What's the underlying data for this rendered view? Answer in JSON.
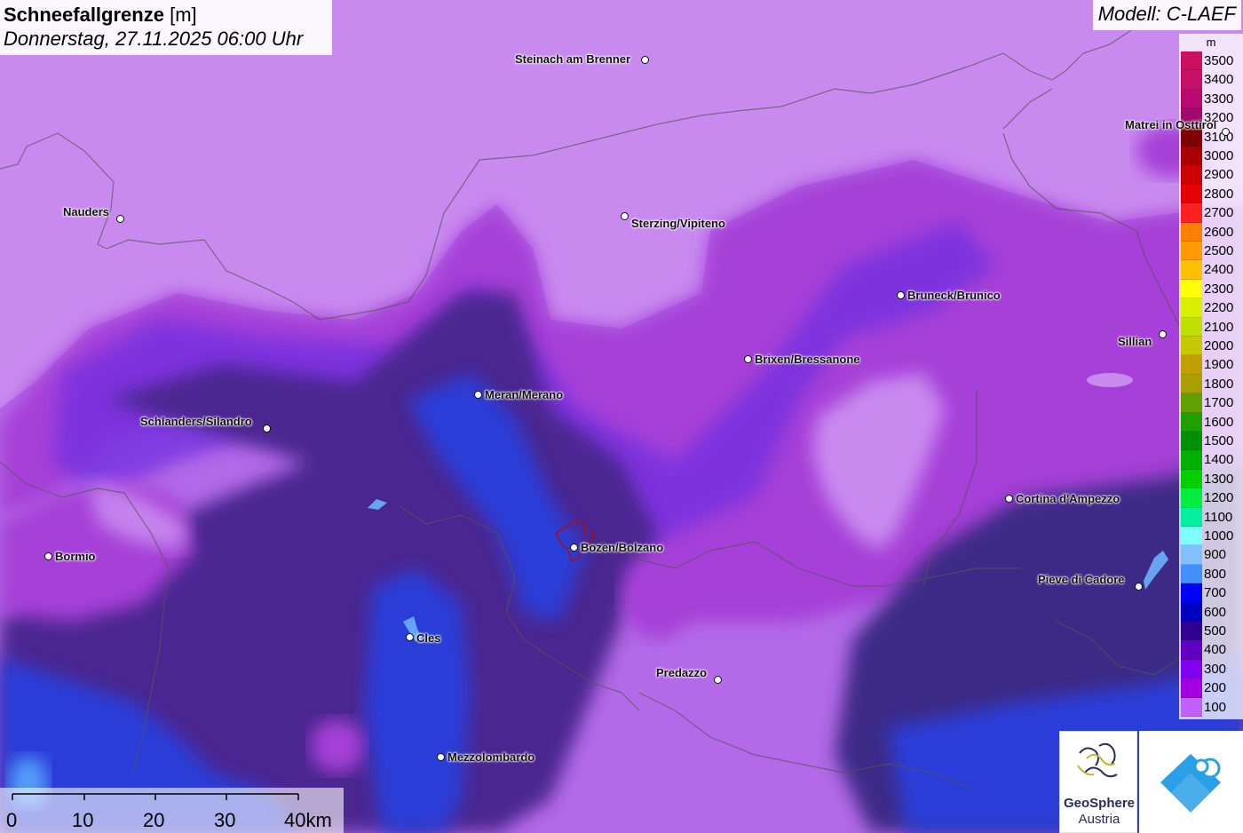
{
  "title": {
    "variable": "Schneefallgrenze",
    "unit": "[m]",
    "datetime": "Donnerstag, 27.11.2025 06:00 Uhr"
  },
  "model": "Modell: C-LAEF",
  "legend": {
    "unit": "m",
    "entries": [
      {
        "label": "3500",
        "color": "#cc1060"
      },
      {
        "label": "3400",
        "color": "#c8106a"
      },
      {
        "label": "3300",
        "color": "#b80a70"
      },
      {
        "label": "3200",
        "color": "#a00a6c"
      },
      {
        "label": "3100",
        "color": "#800000"
      },
      {
        "label": "3000",
        "color": "#a80000"
      },
      {
        "label": "2900",
        "color": "#cc0000"
      },
      {
        "label": "2800",
        "color": "#e80000"
      },
      {
        "label": "2700",
        "color": "#ff2020"
      },
      {
        "label": "2600",
        "color": "#ff7f00"
      },
      {
        "label": "2500",
        "color": "#ff9a00"
      },
      {
        "label": "2400",
        "color": "#ffc000"
      },
      {
        "label": "2300",
        "color": "#ffff00"
      },
      {
        "label": "2200",
        "color": "#d8f000"
      },
      {
        "label": "2100",
        "color": "#c0e000"
      },
      {
        "label": "2000",
        "color": "#c8c800"
      },
      {
        "label": "1900",
        "color": "#c0a000"
      },
      {
        "label": "1800",
        "color": "#a8a000"
      },
      {
        "label": "1700",
        "color": "#60a000"
      },
      {
        "label": "1600",
        "color": "#20a000"
      },
      {
        "label": "1500",
        "color": "#009000"
      },
      {
        "label": "1400",
        "color": "#00b000"
      },
      {
        "label": "1300",
        "color": "#00d000"
      },
      {
        "label": "1200",
        "color": "#00ee40"
      },
      {
        "label": "1100",
        "color": "#00f0a0"
      },
      {
        "label": "1000",
        "color": "#80ffff"
      },
      {
        "label": "900",
        "color": "#80c0ff"
      },
      {
        "label": "800",
        "color": "#4090ff"
      },
      {
        "label": "700",
        "color": "#0000ff"
      },
      {
        "label": "600",
        "color": "#0000c0"
      },
      {
        "label": "500",
        "color": "#300090"
      },
      {
        "label": "400",
        "color": "#6000c0"
      },
      {
        "label": "300",
        "color": "#8000f0"
      },
      {
        "label": "200",
        "color": "#a000e0"
      },
      {
        "label": "100",
        "color": "#c060ff"
      }
    ]
  },
  "cities": [
    {
      "name": "Steinach am Brenner"
    },
    {
      "name": "Nauders"
    },
    {
      "name": "Sterzing/Vipiteno"
    },
    {
      "name": "Matrei in Osttirol"
    },
    {
      "name": "Bruneck/Brunico"
    },
    {
      "name": "Sillian"
    },
    {
      "name": "Brixen/Bressanone"
    },
    {
      "name": "Meran/Merano"
    },
    {
      "name": "Schlanders/Silandro"
    },
    {
      "name": "Bormio"
    },
    {
      "name": "Bozen/Bolzano"
    },
    {
      "name": "Cortina d'Ampezzo"
    },
    {
      "name": "Pieve di Cadore"
    },
    {
      "name": "Cles"
    },
    {
      "name": "Predazzo"
    },
    {
      "name": "Mezzolombardo"
    }
  ],
  "scalebar": {
    "labels": [
      "0",
      "10",
      "20",
      "30",
      "40km"
    ]
  },
  "logos": {
    "geosphere_line1": "GeoSphere",
    "geosphere_line2": "Austria",
    "geosphere_icon": "geosphere-logo",
    "app_icon": "weather-app-logo"
  }
}
